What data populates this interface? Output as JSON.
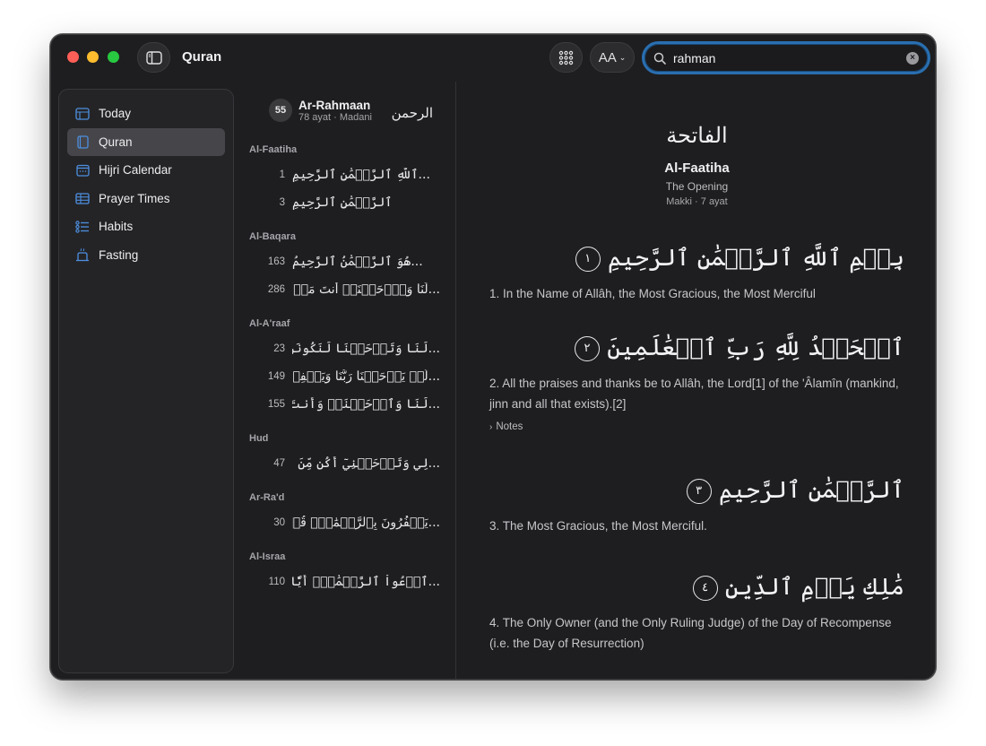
{
  "app": {
    "title": "Quran"
  },
  "toolbar": {
    "font_label": "AA"
  },
  "search": {
    "value": "rahman",
    "placeholder": "Search"
  },
  "sidebar": {
    "items": [
      {
        "label": "Today",
        "icon": "today-icon"
      },
      {
        "label": "Quran",
        "icon": "book-icon",
        "active": true
      },
      {
        "label": "Hijri Calendar",
        "icon": "calendar-icon"
      },
      {
        "label": "Prayer Times",
        "icon": "table-icon"
      },
      {
        "label": "Habits",
        "icon": "checklist-icon"
      },
      {
        "label": "Fasting",
        "icon": "fasting-icon"
      }
    ]
  },
  "results": {
    "surah_header": {
      "number": "55",
      "name": "Ar-Rahmaan",
      "meta": "78 ayat · Madani",
      "arabic": "الرحمن"
    },
    "groups": [
      {
        "title": "Al-Faatiha",
        "rows": [
          {
            "num": "1",
            "text": "...ٱللَّهِ ٱلرَّحۡمَٰنِ ٱلرَّحِيمِ"
          },
          {
            "num": "3",
            "text": "ٱلرَّحۡمَٰنِ ٱلرَّحِيمِ"
          }
        ]
      },
      {
        "title": "Al-Baqara",
        "rows": [
          {
            "num": "163",
            "text": "...هُوَ ٱلرَّحۡمَٰنُ ٱلرَّحِيمُ"
          },
          {
            "num": "286",
            "text": "...لَنَا وَٱرۡحَمۡنَآۚ أَنتَ مَوۡلَىٰنَا فَٱنصُرۡنَا..."
          }
        ]
      },
      {
        "title": "Al-A'raaf",
        "rows": [
          {
            "num": "23",
            "text": "...لَنَا وَتَرۡحَمۡنَا لَنَكُونَنَّ مِنَ ٱلۡخَٰسِرِينَ"
          },
          {
            "num": "149",
            "text": "...لَّمۡ يَرۡحَمۡنَا رَبُّنَا وَيَغۡفِرۡ لَنَا لَنَكُونَنَّ..."
          },
          {
            "num": "155",
            "text": "...لَنَا وَٱرۡحَمۡنَاۖ وَأَنتَ خَيۡرُ ٱلۡغَٰفِرِينَ"
          }
        ]
      },
      {
        "title": "Hud",
        "rows": [
          {
            "num": "47",
            "text": "...لِي وَتَرۡحَمۡنِيٓ أَكُن مِّنَ ٱلۡخَٰسِرِينَ"
          }
        ]
      },
      {
        "title": "Ar-Ra'd",
        "rows": [
          {
            "num": "30",
            "text": "...يَكۡفُرُونَ بِٱلرَّحۡمَٰنِۚ قُلۡ هُوَ رَبِّي لَآ..."
          }
        ]
      },
      {
        "title": "Al-Israa",
        "rows": [
          {
            "num": "110",
            "text": "...ٱدۡعُواْ ٱلرَّحۡمَٰنَۖ أَيّٗا مَّا تَدۡعُواْ فَلَهُ ٱ..."
          }
        ]
      }
    ]
  },
  "reader": {
    "arabic_title": "الفاتحة",
    "name": "Al-Faatiha",
    "subtitle": "The Opening",
    "meta": "Makki · 7 ayat",
    "verses": [
      {
        "arabic": "بِسۡمِ ٱللَّهِ ٱلرَّحۡمَٰنِ ٱلرَّحِيمِ",
        "mark": "١",
        "translation": "1. In the Name of Allâh, the Most Gracious, the Most Merciful"
      },
      {
        "arabic": "ٱلۡحَمۡدُ لِلَّهِ رَبِّ ٱلۡعَٰلَمِينَ",
        "mark": "٢",
        "translation": "2. All the praises and thanks be to Allâh, the Lord[1] of the 'Âlamîn (mankind, jinn and all that exists).[2]",
        "notes": "Notes"
      },
      {
        "arabic": "ٱلرَّحۡمَٰنِ ٱلرَّحِيمِ",
        "mark": "٣",
        "translation": "3. The Most Gracious, the Most Merciful."
      },
      {
        "arabic": "مَٰلِكِ يَوۡمِ ٱلدِّينِ",
        "mark": "٤",
        "translation": "4. The Only Owner (and the Only Ruling Judge) of the Day of Recompense (i.e. the Day of Resurrection)"
      }
    ]
  }
}
